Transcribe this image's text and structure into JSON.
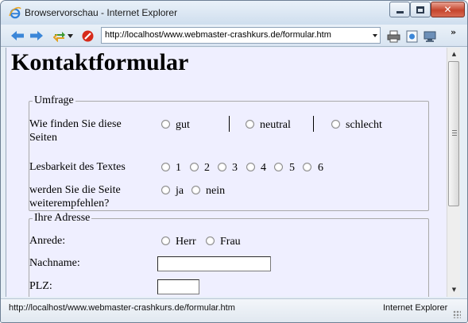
{
  "window": {
    "title": "Browservorschau - Internet Explorer",
    "icons": [
      "ie-logo-icon",
      "minimize-icon",
      "maximize-icon",
      "close-icon"
    ]
  },
  "navbar": {
    "address": "http://localhost/www.webmaster-crashkurs.de/formular.htm",
    "icons": [
      "back-arrow-icon",
      "forward-arrow-icon",
      "refresh-icon",
      "stop-icon",
      "print-icon",
      "page-icon",
      "tools-icon"
    ],
    "more_label": "»"
  },
  "page": {
    "heading": "Kontaktformular",
    "survey": {
      "legend": "Umfrage",
      "q1": {
        "label_line1": "Wie finden Sie diese",
        "label_line2": "Seiten",
        "options": [
          "gut",
          "neutral",
          "schlecht"
        ]
      },
      "q2": {
        "label": "Lesbarkeit des Textes",
        "options": [
          "1",
          "2",
          "3",
          "4",
          "5",
          "6"
        ]
      },
      "q3": {
        "label_line1": "werden Sie die Seite",
        "label_line2": "weiterempfehlen?",
        "options": [
          "ja",
          "nein"
        ]
      }
    },
    "address": {
      "legend": "Ihre Adresse",
      "salutation_label": "Anrede:",
      "salutation_options": [
        "Herr",
        "Frau"
      ],
      "lastname_label": "Nachname:",
      "lastname_value": "",
      "zip_label": "PLZ:",
      "zip_value": ""
    }
  },
  "statusbar": {
    "url": "http://localhost/www.webmaster-crashkurs.de/formular.htm",
    "zone": "Internet Explorer"
  },
  "colors": {
    "page_background": "#efefff",
    "chrome": "#dbe6f2",
    "close_button": "#c5452d"
  }
}
